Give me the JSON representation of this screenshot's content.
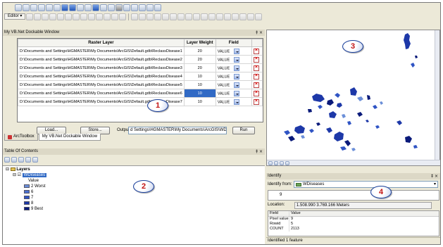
{
  "toolbar": {
    "editor_label": "Editor ▾"
  },
  "dock": {
    "title": "My VB.Net Dockable Window",
    "controls": "‡ ×",
    "columns": [
      "Raster Layer",
      "Layer Weight",
      "Field"
    ],
    "rows": [
      {
        "layer": "D:\\Documents and Settings\\HGMASTER\\My Documents\\ArcGIS\\Default.gdb\\ReclassDisease1",
        "weight": "20",
        "field": "VALUE"
      },
      {
        "layer": "D:\\Documents and Settings\\HGMASTER\\My Documents\\ArcGIS\\Default.gdb\\ReclassDisease2",
        "weight": "20",
        "field": "VALUE"
      },
      {
        "layer": "D:\\Documents and Settings\\HGMASTER\\My Documents\\ArcGIS\\Default.gdb\\ReclassDisease3",
        "weight": "20",
        "field": "VALUE"
      },
      {
        "layer": "D:\\Documents and Settings\\HGMASTER\\My Documents\\ArcGIS\\Default.gdb\\ReclassDisease4",
        "weight": "10",
        "field": "VALUE"
      },
      {
        "layer": "D:\\Documents and Settings\\HGMASTER\\My Documents\\ArcGIS\\Default.gdb\\ReclassDisease5",
        "weight": "10",
        "field": "VALUE"
      },
      {
        "layer": "D:\\Documents and Settings\\HGMASTER\\My Documents\\ArcGIS\\Default.gdb\\ReclassDisease6",
        "weight": "10",
        "field": "VALUE"
      },
      {
        "layer": "D:\\Documents and Settings\\HGMASTER\\My Documents\\ArcGIS\\Default.gdb\\ReclassDisease7",
        "weight": "10",
        "field": "VALUE"
      }
    ],
    "load_label": "Load...",
    "store_label": "Store...",
    "output_label": "Output",
    "output_value": "d Settings\\HGMASTER\\My Documents\\ArcGIS\\WDiseases",
    "run_label": "Run"
  },
  "tabs": [
    "ArcToolbox",
    "My VB.Net Dockable Window"
  ],
  "toc": {
    "title": "Table Of Contents",
    "controls": "‡ ×",
    "root": "Layers",
    "layer": "WDiseases",
    "value_label": "Value",
    "legend": [
      {
        "label": "2 Worst",
        "color": "#6b8fd8"
      },
      {
        "label": "6",
        "color": "#4a6fd0"
      },
      {
        "label": "7",
        "color": "#2f54c4"
      },
      {
        "label": "8",
        "color": "#1d38a8"
      },
      {
        "label": "9 Best",
        "color": "#0a1a7a"
      }
    ]
  },
  "identify": {
    "title": "Identify",
    "controls": "‡ ×",
    "from_label": "Identify from:",
    "from_value": "WDiseases",
    "tree_item": "9",
    "location_label": "Location:",
    "location_value": "1.508.990  3.769.166 Meters",
    "attr_headers": [
      "Field",
      "Value"
    ],
    "attrs": [
      {
        "field": "Pixel value",
        "value": "9"
      },
      {
        "field": "Rowid",
        "value": "5"
      },
      {
        "field": "COUNT",
        "value": "2113"
      }
    ],
    "status": "Identified 1 feature"
  },
  "callouts": [
    "1",
    "2",
    "3",
    "4"
  ],
  "colors": {
    "map_dark": "#0a1a7a",
    "map_mid": "#2f54c4",
    "map_light": "#6b8fd8",
    "callout_text": "#c21414"
  }
}
